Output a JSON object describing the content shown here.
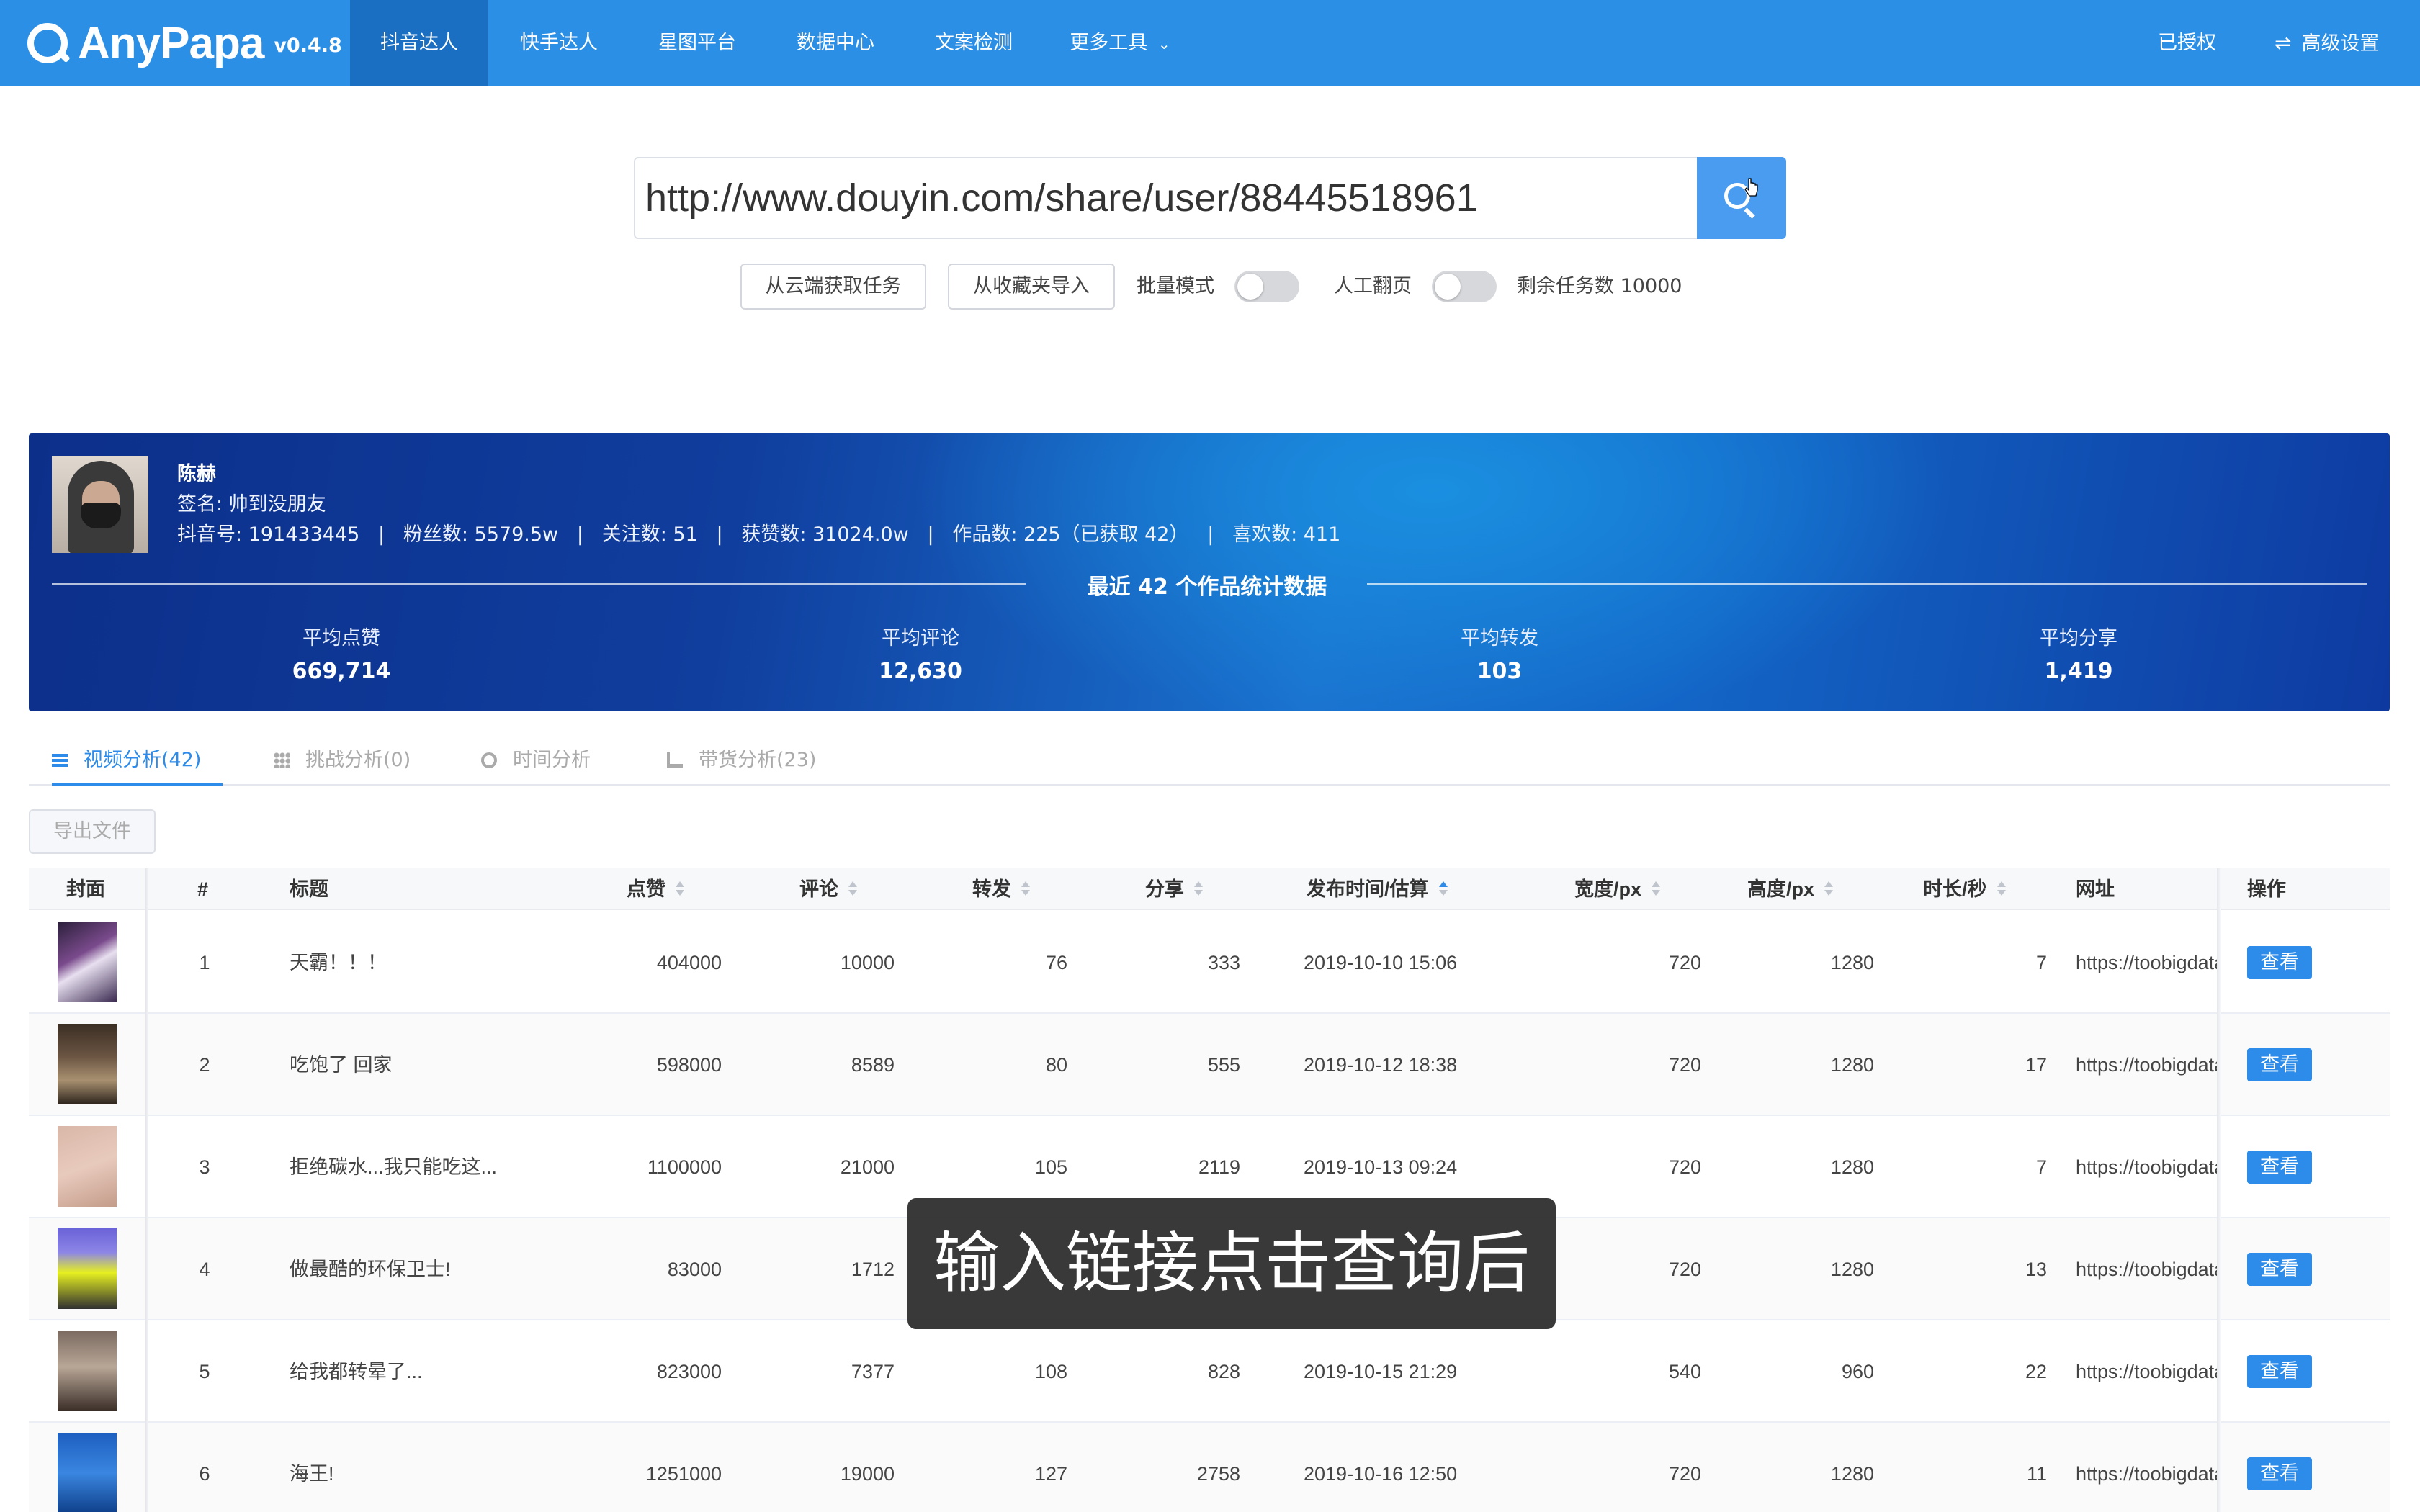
{
  "app": {
    "name": "AnyPapa",
    "version": "v0.4.8"
  },
  "nav": {
    "items": [
      "抖音达人",
      "快手达人",
      "星图平台",
      "数据中心",
      "文案检测",
      "更多工具"
    ],
    "active": "抖音达人",
    "authorized": "已授权",
    "settings": "高级设置"
  },
  "search": {
    "value": "http://www.douyin.com/share/user/88445518961",
    "cloud_btn": "从云端获取任务",
    "fav_btn": "从收藏夹导入",
    "batch_label": "批量模式",
    "manual_label": "人工翻页",
    "remaining": "剩余任务数 10000"
  },
  "profile": {
    "name": "陈赫",
    "signature": "签名: 帅到没朋友",
    "meta": "抖音号: 191433445   |   粉丝数: 5579.5w   |   关注数: 51   |   获赞数: 31024.0w   |   作品数: 225（已获取 42）   |   喜欢数: 411",
    "stats_title": "最近 42 个作品统计数据",
    "stats": [
      {
        "label": "平均点赞",
        "value": "669,714"
      },
      {
        "label": "平均评论",
        "value": "12,630"
      },
      {
        "label": "平均转发",
        "value": "103"
      },
      {
        "label": "平均分享",
        "value": "1,419"
      }
    ]
  },
  "tabs": [
    {
      "label": "视频分析(42)",
      "icon": "list-icon"
    },
    {
      "label": "挑战分析(0)",
      "icon": "grid-icon"
    },
    {
      "label": "时间分析",
      "icon": "clock-icon"
    },
    {
      "label": "带货分析(23)",
      "icon": "cart-icon"
    }
  ],
  "export_label": "导出文件",
  "table": {
    "headers": [
      "封面",
      "#",
      "标题",
      "点赞",
      "评论",
      "转发",
      "分享",
      "发布时间/估算",
      "宽度/px",
      "高度/px",
      "时长/秒",
      "网址",
      "操作"
    ],
    "view_label": "查看",
    "rows": [
      {
        "index": "1",
        "title": "天霸！！！",
        "likes": "404000",
        "comments": "10000",
        "forwards": "76",
        "shares": "333",
        "time": "2019-10-10 15:06",
        "width": "720",
        "height": "1280",
        "duration": "7",
        "url": "https://toobigdata"
      },
      {
        "index": "2",
        "title": "吃饱了 回家",
        "likes": "598000",
        "comments": "8589",
        "forwards": "80",
        "shares": "555",
        "time": "2019-10-12 18:38",
        "width": "720",
        "height": "1280",
        "duration": "17",
        "url": "https://toobigdata"
      },
      {
        "index": "3",
        "title": "拒绝碳水...我只能吃这...",
        "likes": "1100000",
        "comments": "21000",
        "forwards": "105",
        "shares": "2119",
        "time": "2019-10-13 09:24",
        "width": "720",
        "height": "1280",
        "duration": "7",
        "url": "https://toobigdata"
      },
      {
        "index": "4",
        "title": "做最酷的环保卫士!",
        "likes": "83000",
        "comments": "1712",
        "forwards": "",
        "shares": "",
        "time": "",
        "width": "720",
        "height": "1280",
        "duration": "13",
        "url": "https://toobigdata"
      },
      {
        "index": "5",
        "title": "给我都转晕了...",
        "likes": "823000",
        "comments": "7377",
        "forwards": "108",
        "shares": "828",
        "time": "2019-10-15 21:29",
        "width": "540",
        "height": "960",
        "duration": "22",
        "url": "https://toobigdata"
      },
      {
        "index": "6",
        "title": "海王!",
        "likes": "1251000",
        "comments": "19000",
        "forwards": "127",
        "shares": "2758",
        "time": "2019-10-16 12:50",
        "width": "720",
        "height": "1280",
        "duration": "11",
        "url": "https://toobigdata"
      }
    ]
  },
  "caption": "输入链接点击查询后",
  "colors": {
    "nav_bg": "#2c8fe6",
    "nav_active": "#1a6fc2",
    "primary": "#2d8ce9",
    "banner_dark": "#0c2f8a",
    "banner_light": "#1a8fe0"
  }
}
